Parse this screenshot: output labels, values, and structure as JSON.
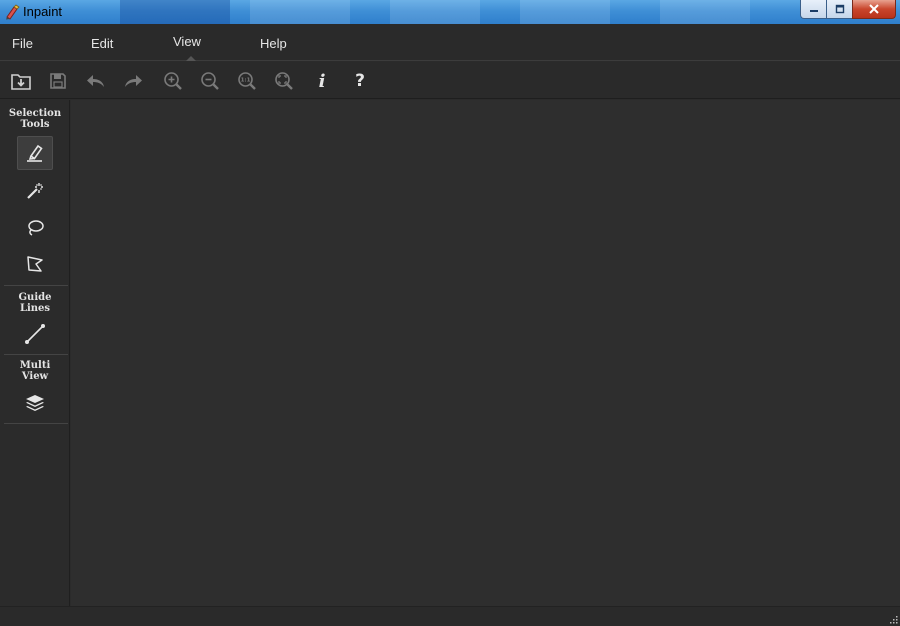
{
  "window": {
    "title": "Inpaint",
    "app_icon": "inpaint-app-icon",
    "controls": [
      "minimize-icon",
      "maximize-icon",
      "close-icon"
    ]
  },
  "menu": {
    "file": "File",
    "edit": "Edit",
    "view": "View",
    "help": "Help",
    "active": "View"
  },
  "toolbar": {
    "info_label": "i",
    "help_label": "?",
    "zoom_actual_label": "1:1",
    "icons": [
      "open-icon",
      "save-icon",
      "undo-icon",
      "redo-icon",
      "zoom-in-icon",
      "zoom-out-icon",
      "zoom-actual-icon",
      "zoom-fit-icon",
      "info-icon",
      "help-icon"
    ]
  },
  "sidebar": {
    "selection_tools_title_1": "Selection",
    "selection_tools_title_2": "Tools",
    "guide_lines_title_1": "Guide",
    "guide_lines_title_2": "Lines",
    "multi_view_title_1": "Multi",
    "multi_view_title_2": "View",
    "tools": [
      "marker-icon",
      "magic-wand-icon",
      "lasso-icon",
      "polygonal-lasso-icon",
      "guide-line-icon",
      "layers-icon"
    ],
    "active_tool": "marker-icon"
  },
  "colors": {
    "background": "#2b2b2b",
    "canvas": "#2e2e2e",
    "text": "#e6e6e6",
    "icon": "#cfcfcf",
    "icon_disabled": "#7a7a7a",
    "titlebar": "#3f8fd6"
  }
}
